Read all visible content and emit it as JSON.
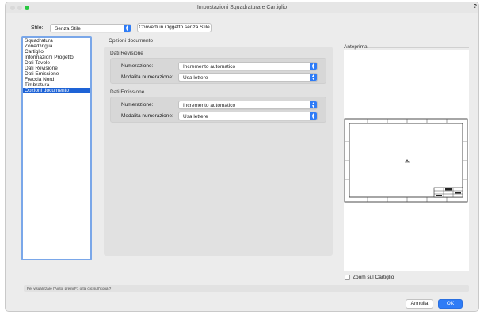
{
  "window": {
    "title": "Impostazioni Squadratura e Cartiglio",
    "help": "?"
  },
  "style": {
    "label": "Stile:",
    "selected": "Senza Stile",
    "convert_button": "Converti in Oggetto senza Stile"
  },
  "sidebar": {
    "items": [
      {
        "label": "Squadratura"
      },
      {
        "label": "Zone/Griglia"
      },
      {
        "label": "Cartiglio"
      },
      {
        "label": "Informazioni Progetto"
      },
      {
        "label": "Dati Tavole"
      },
      {
        "label": "Dati Revisione"
      },
      {
        "label": "Dati Emissione"
      },
      {
        "label": "Freccia Nord"
      },
      {
        "label": "Timbratura"
      },
      {
        "label": "Opzioni documento"
      }
    ],
    "selected_index": 9
  },
  "panel": {
    "title": "Opzioni documento",
    "revisione": {
      "label": "Dati Revisione",
      "numerazione_label": "Numerazione:",
      "numerazione_value": "Incremento automatico",
      "modalita_label": "Modalità numerazione:",
      "modalita_value": "Usa lettere"
    },
    "emissione": {
      "label": "Dati Emissione",
      "numerazione_label": "Numerazione:",
      "numerazione_value": "Incremento automatico",
      "modalita_label": "Modalità numerazione:",
      "modalita_value": "Usa lettere"
    }
  },
  "preview": {
    "label": "Anteprima",
    "zoom_label": "Zoom sul Cartiglio",
    "zoom_checked": false
  },
  "status": {
    "text": "Per visualizzare l'Aiuto, premi F1 o fai clic sull'icona ?"
  },
  "footer": {
    "cancel_label": "Annulla",
    "ok_label": "OK"
  },
  "colors": {
    "accent": "#2f7cf6",
    "selection": "#1e63d6",
    "zoom_green": "#28c840"
  }
}
